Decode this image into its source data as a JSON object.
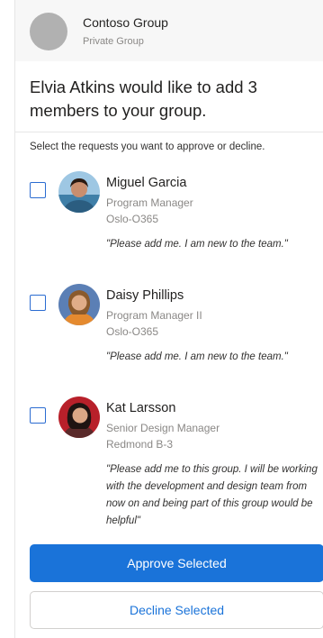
{
  "group": {
    "name": "Contoso Group",
    "type": "Private Group"
  },
  "title": "Elvia Atkins would like to add 3 members to your group.",
  "instruction": "Select the requests you want to approve or decline.",
  "requests": [
    {
      "name": "Miguel Garcia",
      "role": "Program Manager",
      "location": "Oslo-O365",
      "quote": "\"Please add me. I am new to the team.\""
    },
    {
      "name": "Daisy Phillips",
      "role": "Program Manager II",
      "location": "Oslo-O365",
      "quote": "\"Please add me. I am new to the team.\""
    },
    {
      "name": "Kat Larsson",
      "role": "Senior Design Manager",
      "location": "Redmond B-3",
      "quote": "\"Please add me to this group. I will be working with the development and design team from now on and being part of this group would be helpful\""
    }
  ],
  "buttons": {
    "approve": "Approve Selected",
    "decline": "Decline Selected"
  },
  "colors": {
    "accent": "#1a73d9",
    "header_bg": "#f7f7f7"
  }
}
